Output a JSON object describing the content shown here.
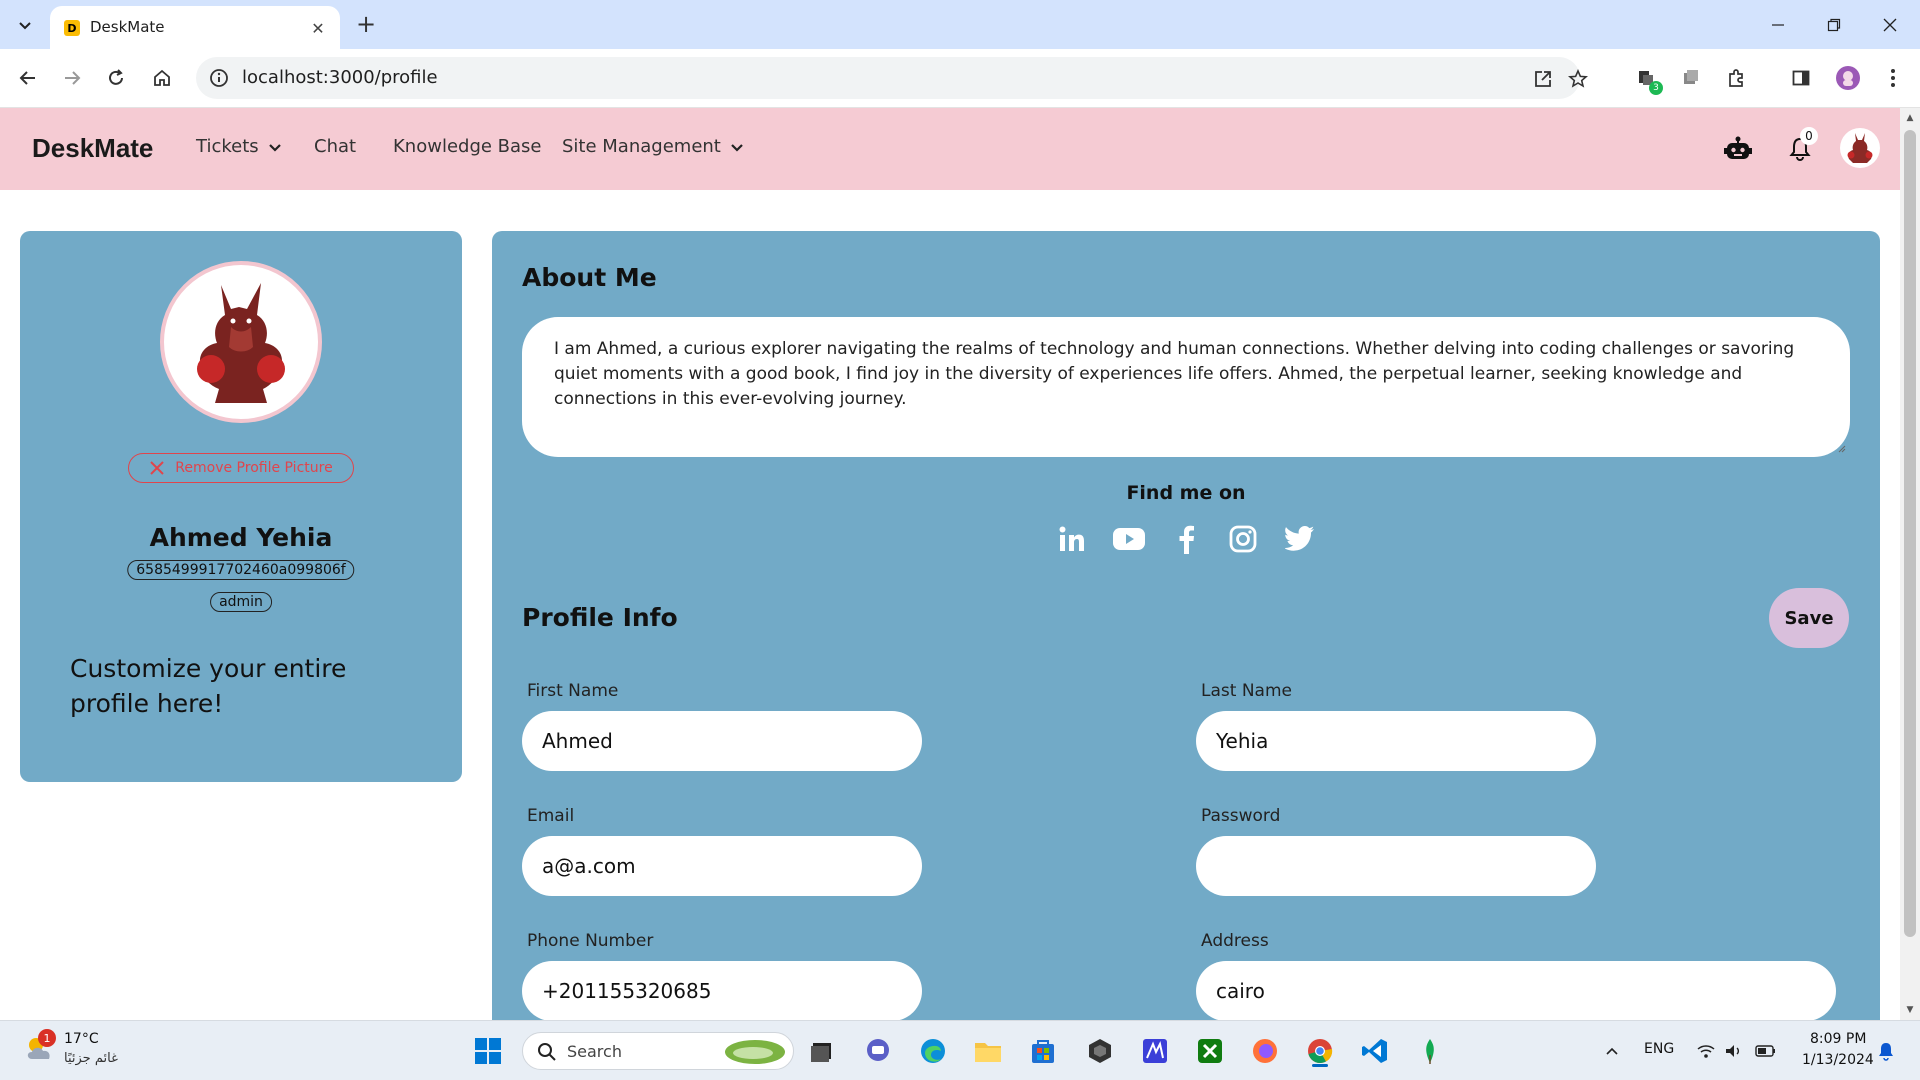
{
  "browser": {
    "tab_title": "DeskMate",
    "tab_favicon_letter": "D",
    "url": "localhost:3000/profile",
    "extension_badge": "3"
  },
  "nav": {
    "brand": "DeskMate",
    "items": [
      {
        "label": "Tickets",
        "has_dropdown": true
      },
      {
        "label": "Chat",
        "has_dropdown": false
      },
      {
        "label": "Knowledge Base",
        "has_dropdown": false
      },
      {
        "label": "Site Management",
        "has_dropdown": true
      }
    ],
    "notification_count": "0"
  },
  "profile_card": {
    "remove_picture_label": "Remove Profile Picture",
    "name": "Ahmed Yehia",
    "user_id": "6585499917702460a099806f",
    "role": "admin",
    "customize_text": "Customize your entire profile here!"
  },
  "about": {
    "title": "About Me",
    "text": "I am Ahmed, a curious explorer navigating the realms of technology and human connections. Whether delving into coding challenges or savoring quiet moments with a good book, I find joy in the diversity of experiences life offers. Ahmed, the perpetual learner, seeking knowledge and connections in this ever-evolving journey.",
    "find_me_on": "Find me on",
    "socials": [
      "linkedin-icon",
      "youtube-icon",
      "facebook-icon",
      "instagram-icon",
      "twitter-icon"
    ]
  },
  "profile_info": {
    "title": "Profile Info",
    "save_label": "Save",
    "fields": {
      "first_name": {
        "label": "First Name",
        "value": "Ahmed"
      },
      "last_name": {
        "label": "Last Name",
        "value": "Yehia"
      },
      "email": {
        "label": "Email",
        "value": "a@a.com"
      },
      "password": {
        "label": "Password",
        "value": ""
      },
      "phone": {
        "label": "Phone Number",
        "value": "+201155320685"
      },
      "address": {
        "label": "Address",
        "value": "cairo"
      }
    }
  },
  "taskbar": {
    "weather_temp": "17°C",
    "weather_condition": "غائم جزئيًا",
    "weather_badge": "1",
    "search_label": "Search",
    "language": "ENG",
    "time": "8:09 PM",
    "date": "1/13/2024"
  },
  "colors": {
    "navbar": "#f5cbd3",
    "card": "#72aac7",
    "save_button": "#d9bfdc",
    "danger": "#e0454c"
  }
}
